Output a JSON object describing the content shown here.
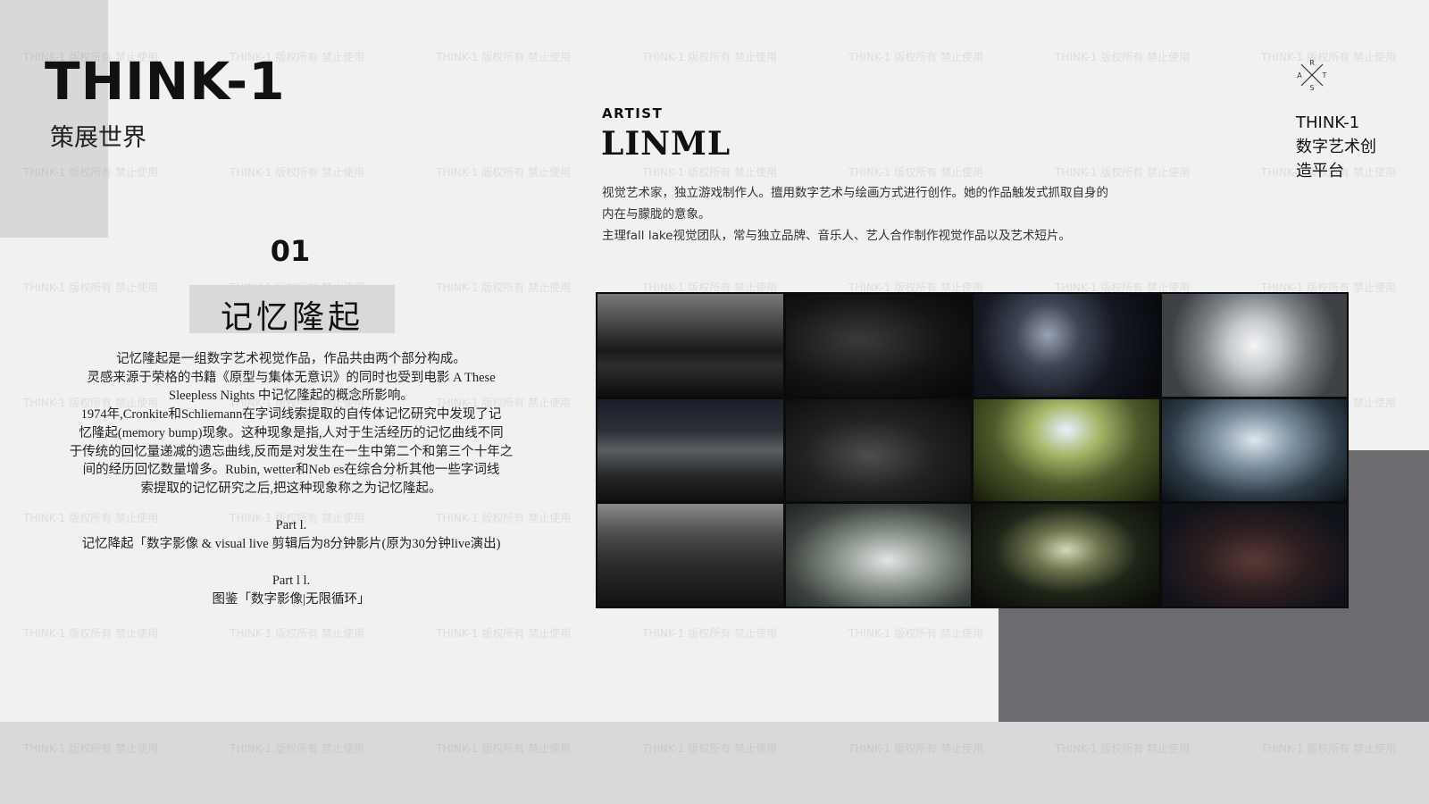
{
  "brand": {
    "name": "THINK-1",
    "subtitle": "策展世界"
  },
  "watermark": {
    "text": "THINK-1 版权所有 禁止使用"
  },
  "section": {
    "number": "01",
    "title": "记忆隆起",
    "description_lines": [
      "记忆隆起是一组数字艺术视觉作品，作品共由两个部分构成。",
      "灵感来源于荣格的书籍《原型与集体无意识》的同时也受到电影 A These",
      "Sleepless Nights 中记忆隆起的概念所影响。",
      "1974年,Cronkite和Schliemann在字词线索提取的自传体记忆研究中发现了记",
      "忆隆起(memory bump)现象。这种现象是指,人对于生活经历的记忆曲线不同",
      "于传统的回忆量递减的遗忘曲线,反而是对发生在一生中第二个和第三个十年之",
      "间的经历回忆数量增多。Rubin, wetter和Neb es在综合分析其他一些字词线",
      "索提取的记忆研究之后,把这种现象称之为记忆隆起。"
    ],
    "part1": {
      "label": "Part l.",
      "text": "记忆降起「数字影像 & visual live 剪辑后为8分钟影片(原为30分钟live演出)"
    },
    "part2": {
      "label": "Part l l.",
      "text": "图鉴「数字影像|无限循环」"
    }
  },
  "artist": {
    "label": "ARTIST",
    "name": "LINML",
    "bio_lines": [
      "视觉艺术家，独立游戏制作人。擅用数字艺术与绘画方式进行创作。她的作品触发式抓取自身的",
      "内在与朦胧的意象。",
      "主理fall lake视觉团队，常与独立品牌、音乐人、艺人合作制作视觉作品以及艺术短片。"
    ]
  },
  "gallery": {
    "tiles": [
      {
        "name": "tile-misty-mountains"
      },
      {
        "name": "tile-dark-figure"
      },
      {
        "name": "tile-chrome-sculpture"
      },
      {
        "name": "tile-glowing-crystal"
      },
      {
        "name": "tile-lake-shore"
      },
      {
        "name": "tile-forest-figure"
      },
      {
        "name": "tile-green-temple"
      },
      {
        "name": "tile-glowing-cylinder"
      },
      {
        "name": "tile-mountain-figure"
      },
      {
        "name": "tile-silver-form"
      },
      {
        "name": "tile-ornament"
      },
      {
        "name": "tile-dark-dome"
      }
    ]
  },
  "platform": {
    "logo_letters": [
      "R",
      "A",
      "T",
      "S"
    ],
    "lines": [
      "THINK-1",
      "数字艺术创",
      "造平台"
    ]
  },
  "colors": {
    "background": "#f1f1f1",
    "gray_block": "#d8d8d8",
    "dark_block": "#6c6c70",
    "bottom_band": "#d9d9dc",
    "title_box": "#d9d9d9"
  }
}
